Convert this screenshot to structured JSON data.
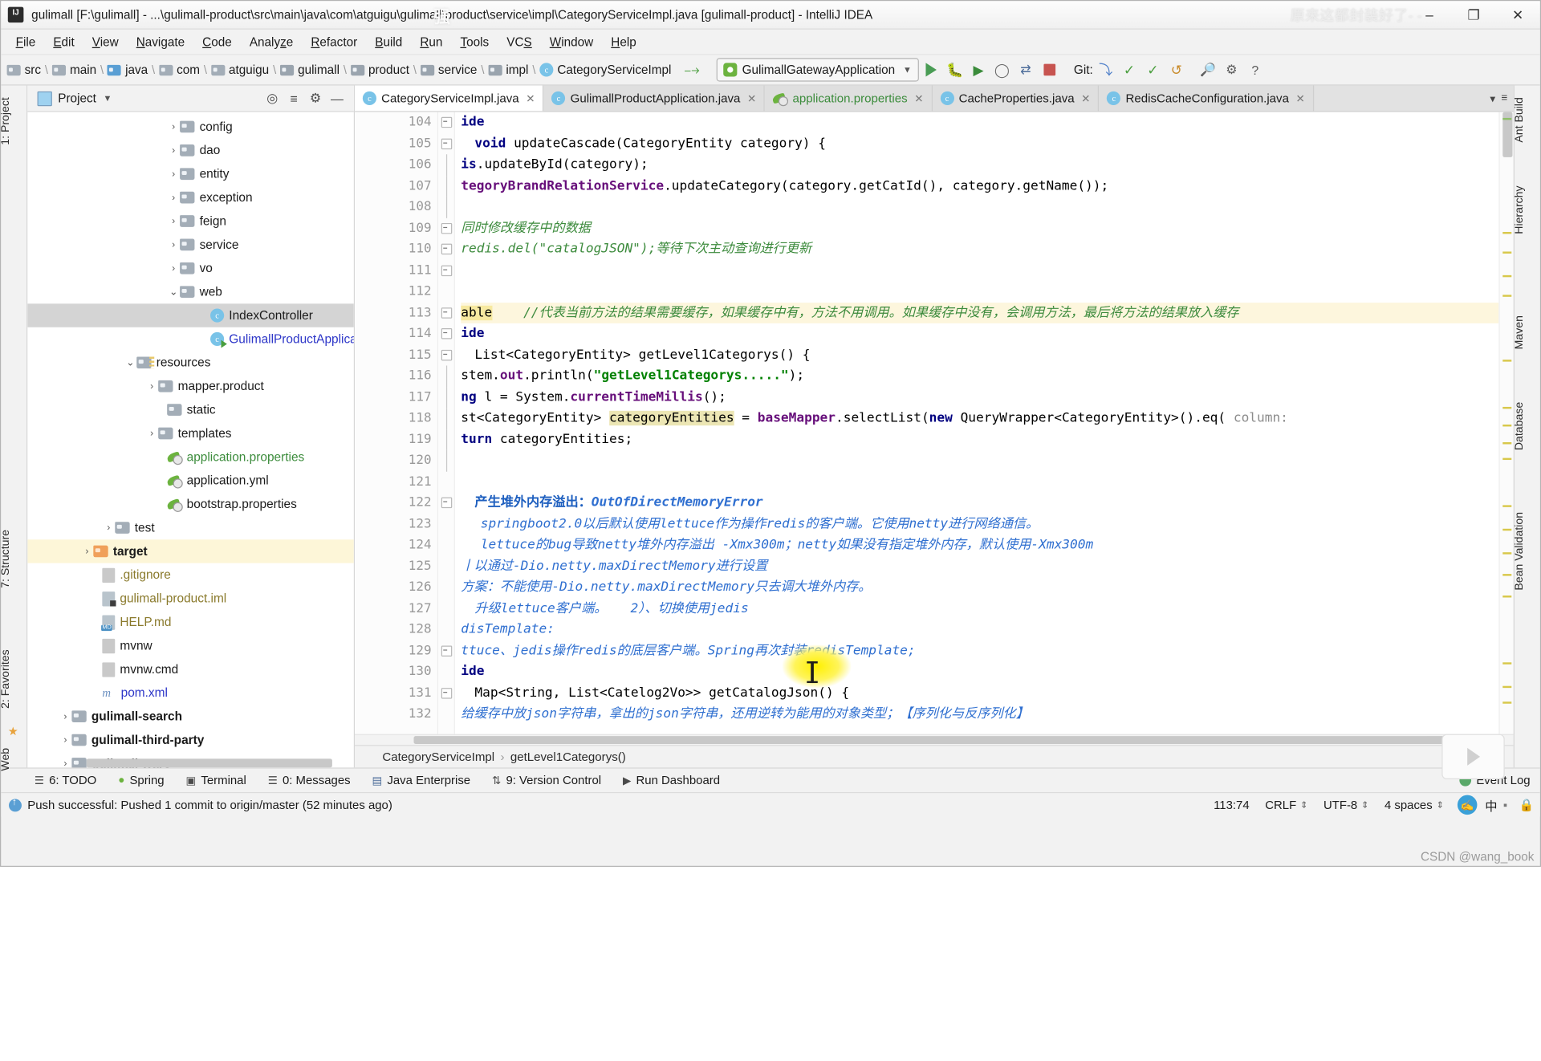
{
  "window": {
    "title": "gulimall [F:\\gulimall] - ...\\gulimall-product\\src\\main\\java\\com\\atguigu\\gulimall\\product\\service\\impl\\CategoryServiceImpl.java [gulimall-product] - IntelliJ IDEA",
    "minimize": "–",
    "maximize": "❐",
    "close": "✕",
    "watermark_right": "原来这都封装好了-  -",
    "watermark_center": "强"
  },
  "menu": [
    {
      "label": "File"
    },
    {
      "label": "Edit"
    },
    {
      "label": "View"
    },
    {
      "label": "Navigate"
    },
    {
      "label": "Code"
    },
    {
      "label": "Analyze"
    },
    {
      "label": "Refactor"
    },
    {
      "label": "Build"
    },
    {
      "label": "Run"
    },
    {
      "label": "Tools"
    },
    {
      "label": "VCS"
    },
    {
      "label": "Window"
    },
    {
      "label": "Help"
    }
  ],
  "navbar": {
    "crumbs": [
      {
        "label": "src",
        "icon": "folder-icon"
      },
      {
        "label": "main",
        "icon": "folder-icon"
      },
      {
        "label": "java",
        "icon": "folder-blue-icon"
      },
      {
        "label": "com",
        "icon": "folder-icon"
      },
      {
        "label": "atguigu",
        "icon": "folder-icon"
      },
      {
        "label": "gulimall",
        "icon": "folder-icon"
      },
      {
        "label": "product",
        "icon": "folder-icon"
      },
      {
        "label": "service",
        "icon": "folder-icon"
      },
      {
        "label": "impl",
        "icon": "folder-icon"
      },
      {
        "label": "CategoryServiceImpl",
        "icon": "class-icon"
      }
    ],
    "run_config": "GulimallGatewayApplication",
    "git_label": "Git:"
  },
  "project": {
    "header_title": "Project",
    "tree": [
      {
        "label": "config",
        "arrow": "›",
        "icon": "folder",
        "indent": 142,
        "state": "normal"
      },
      {
        "label": "dao",
        "arrow": "›",
        "icon": "folder",
        "indent": 142,
        "state": "normal"
      },
      {
        "label": "entity",
        "arrow": "›",
        "icon": "folder",
        "indent": 142,
        "state": "normal"
      },
      {
        "label": "exception",
        "arrow": "›",
        "icon": "folder",
        "indent": 142,
        "state": "normal"
      },
      {
        "label": "feign",
        "arrow": "›",
        "icon": "folder",
        "indent": 142,
        "state": "normal"
      },
      {
        "label": "service",
        "arrow": "›",
        "icon": "folder",
        "indent": 142,
        "state": "normal"
      },
      {
        "label": "vo",
        "arrow": "›",
        "icon": "folder",
        "indent": 142,
        "state": "normal"
      },
      {
        "label": "web",
        "arrow": "⌄",
        "icon": "folder",
        "indent": 142,
        "state": "normal"
      },
      {
        "label": "IndexController",
        "arrow": "",
        "icon": "class",
        "indent": 186,
        "state": "selected"
      },
      {
        "label": "GulimallProductApplication",
        "arrow": "",
        "icon": "class-run",
        "indent": 186,
        "state": "blue"
      },
      {
        "label": "resources",
        "arrow": "⌄",
        "icon": "resources",
        "indent": 98,
        "state": "normal"
      },
      {
        "label": "mapper.product",
        "arrow": "›",
        "icon": "folder",
        "indent": 120,
        "state": "normal"
      },
      {
        "label": "static",
        "arrow": "",
        "icon": "folder",
        "indent": 142,
        "state": "normal"
      },
      {
        "label": "templates",
        "arrow": "›",
        "icon": "folder",
        "indent": 120,
        "state": "normal"
      },
      {
        "label": "application.properties",
        "arrow": "",
        "icon": "spring",
        "indent": 142,
        "state": "green"
      },
      {
        "label": "application.yml",
        "arrow": "",
        "icon": "spring",
        "indent": 142,
        "state": "normal"
      },
      {
        "label": "bootstrap.properties",
        "arrow": "",
        "icon": "spring",
        "indent": 142,
        "state": "normal"
      },
      {
        "label": "test",
        "arrow": "›",
        "icon": "folder",
        "indent": 76,
        "state": "normal"
      },
      {
        "label": "target",
        "arrow": "›",
        "icon": "folder-orange",
        "indent": 54,
        "state": "highlight"
      },
      {
        "label": ".gitignore",
        "arrow": "",
        "icon": "file",
        "indent": 76,
        "state": "olive"
      },
      {
        "label": "gulimall-product.iml",
        "arrow": "",
        "icon": "file-iml",
        "indent": 76,
        "state": "olive"
      },
      {
        "label": "HELP.md",
        "arrow": "",
        "icon": "file-md",
        "indent": 76,
        "state": "olive"
      },
      {
        "label": "mvnw",
        "arrow": "",
        "icon": "file",
        "indent": 76,
        "state": "normal"
      },
      {
        "label": "mvnw.cmd",
        "arrow": "",
        "icon": "file",
        "indent": 76,
        "state": "normal"
      },
      {
        "label": "pom.xml",
        "arrow": "",
        "icon": "maven",
        "indent": 76,
        "state": "blue"
      },
      {
        "label": "gulimall-search",
        "arrow": "›",
        "icon": "folder",
        "indent": 32,
        "state": "bold"
      },
      {
        "label": "gulimall-third-party",
        "arrow": "›",
        "icon": "folder",
        "indent": 32,
        "state": "bold"
      },
      {
        "label": "gulimall-ware",
        "arrow": "›",
        "icon": "folder",
        "indent": 32,
        "state": "bold"
      }
    ]
  },
  "left_strip": [
    {
      "label": "1: Project"
    },
    {
      "label": "7: Structure"
    },
    {
      "label": "2: Favorites"
    },
    {
      "label": "Web"
    }
  ],
  "right_strip": [
    {
      "label": "Ant Build"
    },
    {
      "label": "Hierarchy"
    },
    {
      "label": "Maven"
    },
    {
      "label": "Database"
    },
    {
      "label": "Bean Validation"
    }
  ],
  "editor_tabs": [
    {
      "label": "CategoryServiceImpl.java",
      "icon": "class-icon",
      "active": true
    },
    {
      "label": "GulimallProductApplication.java",
      "icon": "class-run-icon",
      "active": false
    },
    {
      "label": "application.properties",
      "icon": "spring-icon",
      "active": false
    },
    {
      "label": "CacheProperties.java",
      "icon": "class-icon",
      "active": false
    },
    {
      "label": "RedisCacheConfiguration.java",
      "icon": "class-icon",
      "active": false
    }
  ],
  "code": {
    "first_line": 104,
    "lines": [
      {
        "n": 104,
        "text": "ide",
        "fold": "minus",
        "gicons": []
      },
      {
        "n": 105,
        "text": "void updateCascade(CategoryEntity category) {",
        "fold": "minus",
        "gicons": [
          "override-green",
          "arrow-red"
        ]
      },
      {
        "n": 106,
        "text": "is.updateById(category);",
        "fold": "bar",
        "gicons": []
      },
      {
        "n": 107,
        "text": "tegoryBrandRelationService.updateCategory(category.getCatId(), category.getName());",
        "fold": "bar",
        "gicons": []
      },
      {
        "n": 108,
        "text": "",
        "fold": "bar",
        "gicons": []
      },
      {
        "n": 109,
        "text": "同时修改缓存中的数据",
        "fold": "minus",
        "gicons": []
      },
      {
        "n": 110,
        "text": "redis.del(\"catalogJSON\");等待下次主动查询进行更新",
        "fold": "minus",
        "gicons": []
      },
      {
        "n": 111,
        "text": "",
        "fold": "minus",
        "gicons": []
      },
      {
        "n": 112,
        "text": "",
        "fold": "",
        "gicons": []
      },
      {
        "n": 113,
        "text": "able    //代表当前方法的结果需要缓存，如果缓存中有，方法不用调用。如果缓存中没有，会调用方法，最后将方法的结果放入缓存",
        "fold": "minus",
        "gicons": [
          "bulb"
        ],
        "highlight": true
      },
      {
        "n": 114,
        "text": "ide",
        "fold": "minus",
        "gicons": []
      },
      {
        "n": 115,
        "text": "List<CategoryEntity> getLevel1Categorys() {",
        "fold": "minus",
        "gicons": [
          "override-green",
          "arrow-red"
        ]
      },
      {
        "n": 116,
        "text": "stem.out.println(\"getLevel1Categorys.....\");",
        "fold": "bar",
        "gicons": []
      },
      {
        "n": 117,
        "text": "ng l = System.currentTimeMillis();",
        "fold": "bar",
        "gicons": []
      },
      {
        "n": 118,
        "text": "st<CategoryEntity> categoryEntities = baseMapper.selectList(new QueryWrapper<CategoryEntity>().eq( column:",
        "fold": "bar",
        "gicons": []
      },
      {
        "n": 119,
        "text": "turn categoryEntities;",
        "fold": "bar",
        "gicons": []
      },
      {
        "n": 120,
        "text": "",
        "fold": "bar",
        "gicons": []
      },
      {
        "n": 121,
        "text": "",
        "fold": "",
        "gicons": []
      },
      {
        "n": 122,
        "text": "产生堆外内存溢出：OutOfDirectMemoryError",
        "fold": "minus",
        "gicons": []
      },
      {
        "n": 123,
        "text": "springboot2.0以后默认使用lettuce作为操作redis的客户端。它使用netty进行网络通信。",
        "fold": "",
        "gicons": []
      },
      {
        "n": 124,
        "text": "lettuce的bug导致netty堆外内存溢出 -Xmx300m；netty如果没有指定堆外内存，默认使用-Xmx300m",
        "fold": "",
        "gicons": []
      },
      {
        "n": 125,
        "text": "丨以通过-Dio.netty.maxDirectMemory进行设置",
        "fold": "",
        "gicons": []
      },
      {
        "n": 126,
        "text": "方案：不能使用-Dio.netty.maxDirectMemory只去调大堆外内存。",
        "fold": "",
        "gicons": []
      },
      {
        "n": 127,
        "text": "升级lettuce客户端。   2）、切换使用jedis",
        "fold": "",
        "gicons": []
      },
      {
        "n": 128,
        "text": "disTemplate:",
        "fold": "",
        "gicons": []
      },
      {
        "n": 129,
        "text": "ttuce、jedis操作redis的底层客户端。Spring再次封装redisTemplate;",
        "fold": "minus",
        "gicons": []
      },
      {
        "n": 130,
        "text": "ide",
        "fold": "",
        "gicons": []
      },
      {
        "n": 131,
        "text": "Map<String, List<Catelog2Vo>> getCatalogJson() {",
        "fold": "minus",
        "gicons": [
          "override-green",
          "arrow-red"
        ]
      },
      {
        "n": 132,
        "text": "给缓存中放json字符串，拿出的json字符串，还用逆转为能用的对象类型；【序列化与反序列化】",
        "fold": "",
        "gicons": []
      }
    ]
  },
  "editor_breadcrumb": {
    "class": "CategoryServiceImpl",
    "method": "getLevel1Categorys()",
    "sep": "›"
  },
  "bottom_tools": [
    {
      "label": "6: TODO",
      "icon": "☰"
    },
    {
      "label": "Spring",
      "icon": "●"
    },
    {
      "label": "Terminal",
      "icon": "▣"
    },
    {
      "label": "0: Messages",
      "icon": "☰"
    },
    {
      "label": "Java Enterprise",
      "icon": "▤"
    },
    {
      "label": "9: Version Control",
      "icon": "⇅"
    },
    {
      "label": "Run Dashboard",
      "icon": "▶"
    }
  ],
  "event_log": "Event Log",
  "status": {
    "message": "Push successful: Pushed 1 commit to origin/master (52 minutes ago)",
    "position": "113:74",
    "line_sep": "CRLF",
    "encoding": "UTF-8",
    "indent": "4 spaces",
    "ime_char": "中",
    "ime_dot": "▪"
  },
  "csdn_watermark": "CSDN @wang_book",
  "colors": {
    "accent_blue": "#2d36c8",
    "green": "#59a869",
    "red": "#c75450",
    "orange": "#f0a05a",
    "highlight_yellow": "#fdf6dd"
  }
}
